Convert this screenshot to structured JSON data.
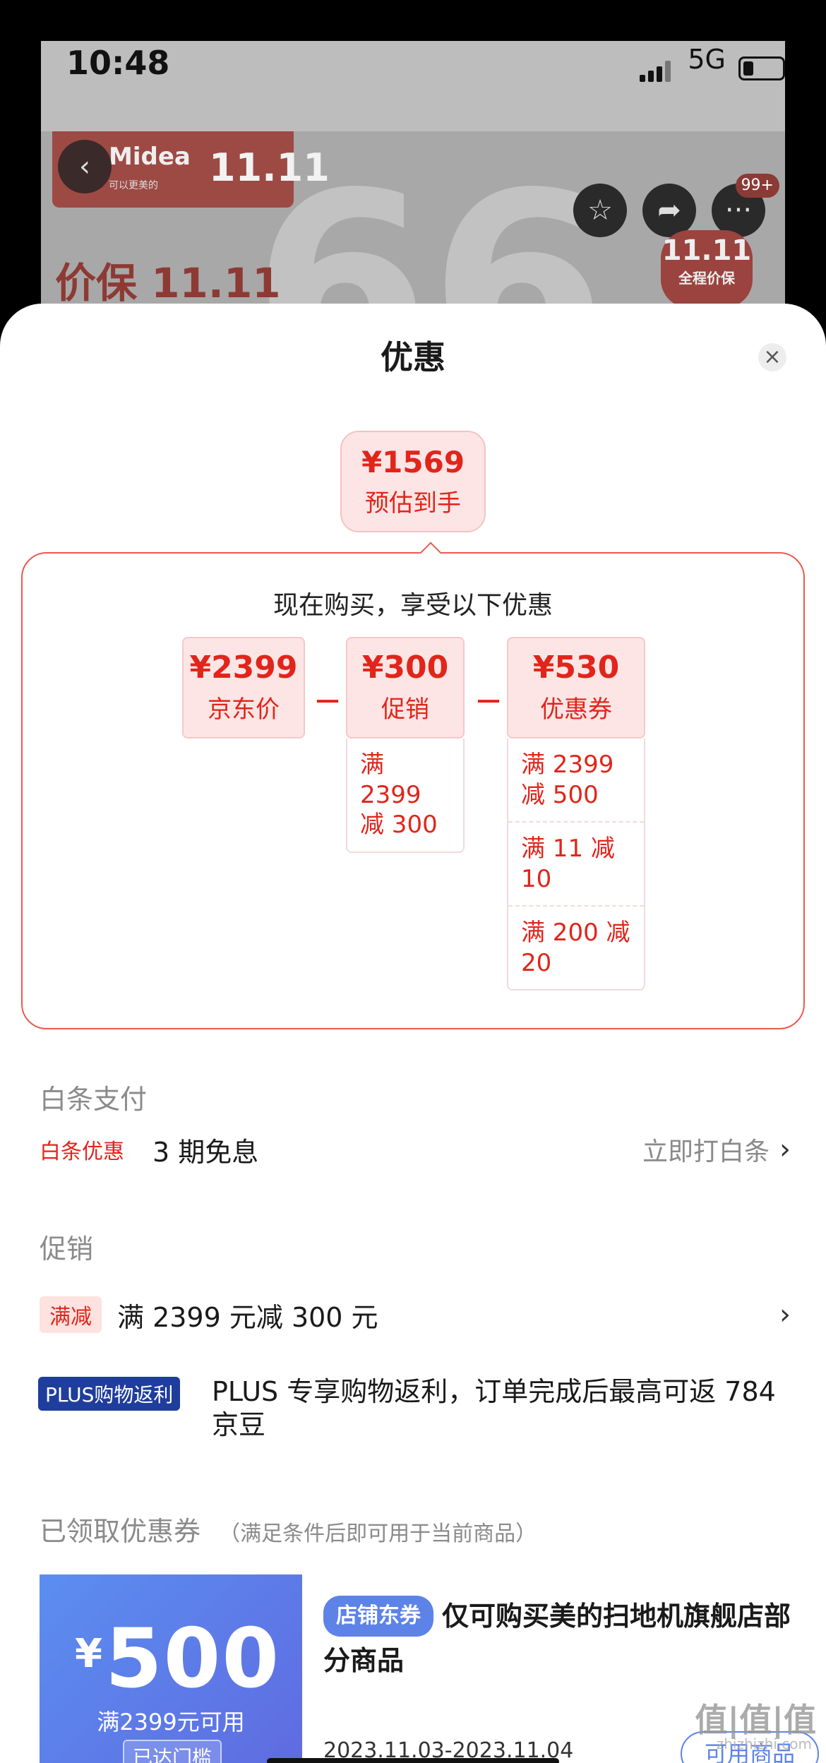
{
  "status_bar": {
    "time": "10:48",
    "network": "5G"
  },
  "background": {
    "brand": "Midea",
    "brand_sub": "可以更美的",
    "event": "11.11",
    "promo_left": "价保 11.11",
    "promo_badge_top": "11.11",
    "promo_badge_bottom": "全程价保",
    "notif_badge": "99+",
    "big_text": "66"
  },
  "sheet": {
    "title": "优惠",
    "final_price": {
      "price": "¥1569",
      "label": "预估到手"
    },
    "calc_header": "现在购买，享受以下优惠",
    "price_cards": [
      {
        "value": "¥2399",
        "name": "京东价"
      },
      {
        "value": "¥300",
        "name": "促销",
        "details": [
          "满 2399 减 300"
        ]
      },
      {
        "value": "¥530",
        "name": "优惠券",
        "details": [
          "满 2399 减 500",
          "满 11 减 10",
          "满 200 减 20"
        ]
      }
    ],
    "operator": "－"
  },
  "baitiao": {
    "section_label": "白条支付",
    "tag": "白条优惠",
    "text": "3 期免息",
    "link": "立即打白条"
  },
  "promotions": {
    "section_label": "促销",
    "full_reduction": {
      "tag": "满减",
      "text": "满 2399 元减 300 元"
    },
    "plus": {
      "tag": "PLUS购物返利",
      "text": "PLUS 专享购物返利，订单完成后最高可返 784 京豆"
    }
  },
  "coupons": {
    "section_label": "已领取优惠券",
    "section_note": "（满足条件后即可用于当前商品）",
    "items": [
      {
        "currency": "¥",
        "amount": "500",
        "condition": "满2399元可用",
        "met_label": "已达门槛",
        "tag": "店铺东券",
        "title": "仅可购买美的扫地机旗舰店部分商品",
        "date_range": "2023.11.03-2023.11.04",
        "use_label": "可用商品"
      }
    ]
  },
  "watermark": {
    "main": "值|值|值",
    "sub": "zhizhizhi.com"
  },
  "colors": {
    "accent_red": "#e1251b",
    "coupon_blue": "#5d83e8",
    "plus_blue": "#1f3d9c"
  }
}
